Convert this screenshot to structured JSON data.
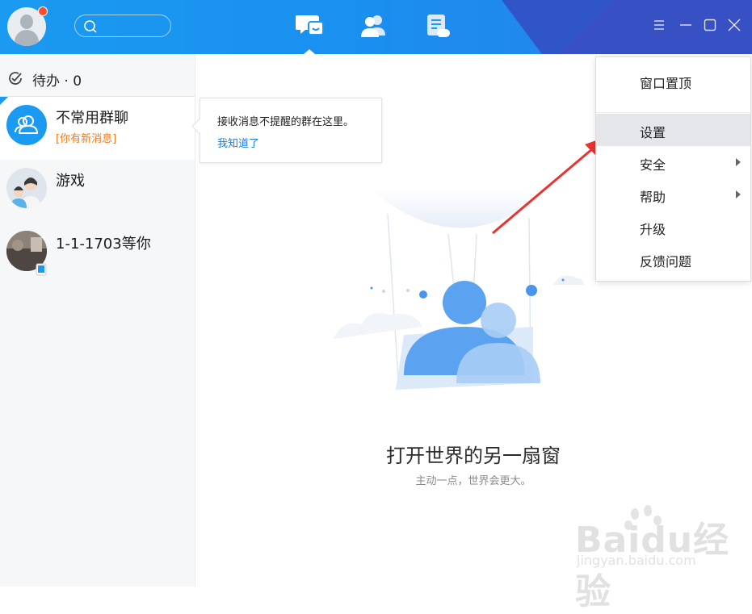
{
  "topbar": {
    "search_placeholder": "",
    "nav_icons": [
      "chat-icon",
      "contacts-icon",
      "document-icon"
    ],
    "window_buttons": [
      "menu-icon",
      "minimize-icon",
      "maximize-icon",
      "close-icon"
    ]
  },
  "sidebar": {
    "todo_label": "待办 · 0",
    "conversations": [
      {
        "name": "不常用群聊",
        "sub": "[你有新消息]",
        "avatar": "group-icon"
      },
      {
        "name": "游戏",
        "sub": "",
        "avatar": "group-photo"
      },
      {
        "name": "1-1-1703等你",
        "sub": "",
        "avatar": "photo"
      }
    ]
  },
  "tooltip": {
    "text": "接收消息不提醒的群在这里。",
    "link": "我知道了"
  },
  "empty_state": {
    "title": "打开世界的另一扇窗",
    "subtitle": "主动一点，世界会更大。"
  },
  "menu": {
    "items": [
      {
        "label": "窗口置顶",
        "submenu": false
      },
      {
        "label": "设置",
        "submenu": false,
        "highlighted": true
      },
      {
        "label": "安全",
        "submenu": true
      },
      {
        "label": "帮助",
        "submenu": true
      },
      {
        "label": "升级",
        "submenu": false
      },
      {
        "label": "反馈问题",
        "submenu": false
      }
    ]
  },
  "watermark": {
    "brand": "Baidu经验",
    "url": "jingyan.baidu.com"
  },
  "colors": {
    "topbar": "#1a9af0",
    "accent_link": "#1a7ee0",
    "new_msg": "#f07a1f",
    "notify_dot": "#ff4b2b",
    "annotation": "#e8342e"
  }
}
